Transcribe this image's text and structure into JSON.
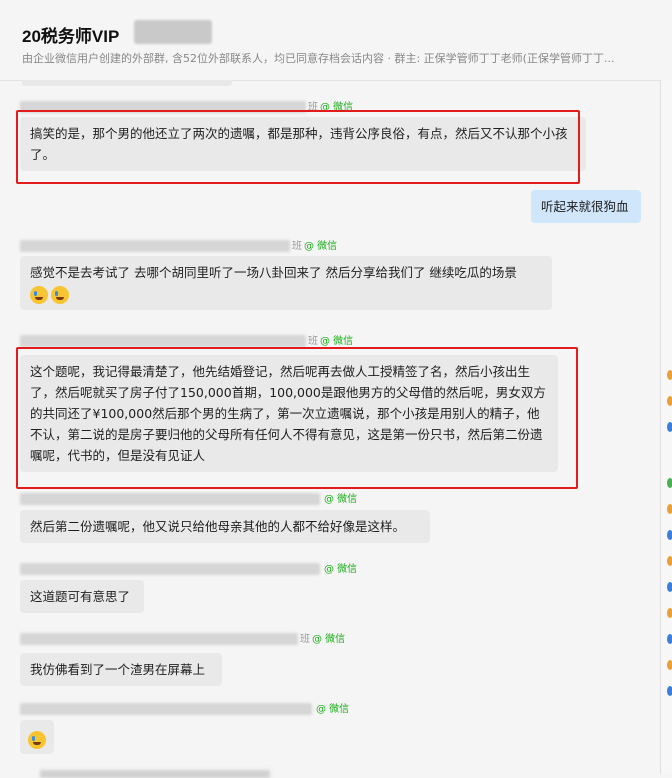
{
  "header": {
    "title": "20税务师VIP",
    "subtitle": "由企业微信用户创建的外部群, 含52位外部联系人，均已同意存档会话内容 · 群主: 正保学管师丁丁老师(正保学管师丁丁..."
  },
  "wechat_tag": "@ 微信",
  "messages": [
    {
      "sender_suffix": "班",
      "text": "搞笑的是，那个男的他还立了两次的遗嘱，都是那种，违背公序良俗，有点，然后又不认那个小孩了。"
    },
    {
      "text": "听起来就很狗血"
    },
    {
      "sender_suffix": "班",
      "text": "感觉不是去考试了   去哪个胡同里听了一场八卦回来了  然后分享给我们了   继续吃瓜的场景"
    },
    {
      "sender_suffix": "班",
      "text": "这个题呢，我记得最清楚了，他先结婚登记，然后呢再去做人工授精签了名，然后小孩出生了，然后呢就买了房子付了150,000首期，100,000是跟他男方的父母借的然后呢，男女双方的共同还了¥100,000然后那个男的生病了，第一次立遗嘱说，那个小孩是用别人的精子，他不认，第二说的是房子要归他的父母所有任何人不得有意见，这是第一份只书，然后第二份遗嘱呢，代书的，但是没有见证人"
    },
    {
      "text": "然后第二份遗嘱呢，他又说只给他母亲其他的人都不给好像是这样。"
    },
    {
      "text": "这道题可有意思了"
    },
    {
      "sender_suffix": "班",
      "text": "我仿佛看到了一个渣男在屏幕上"
    }
  ]
}
